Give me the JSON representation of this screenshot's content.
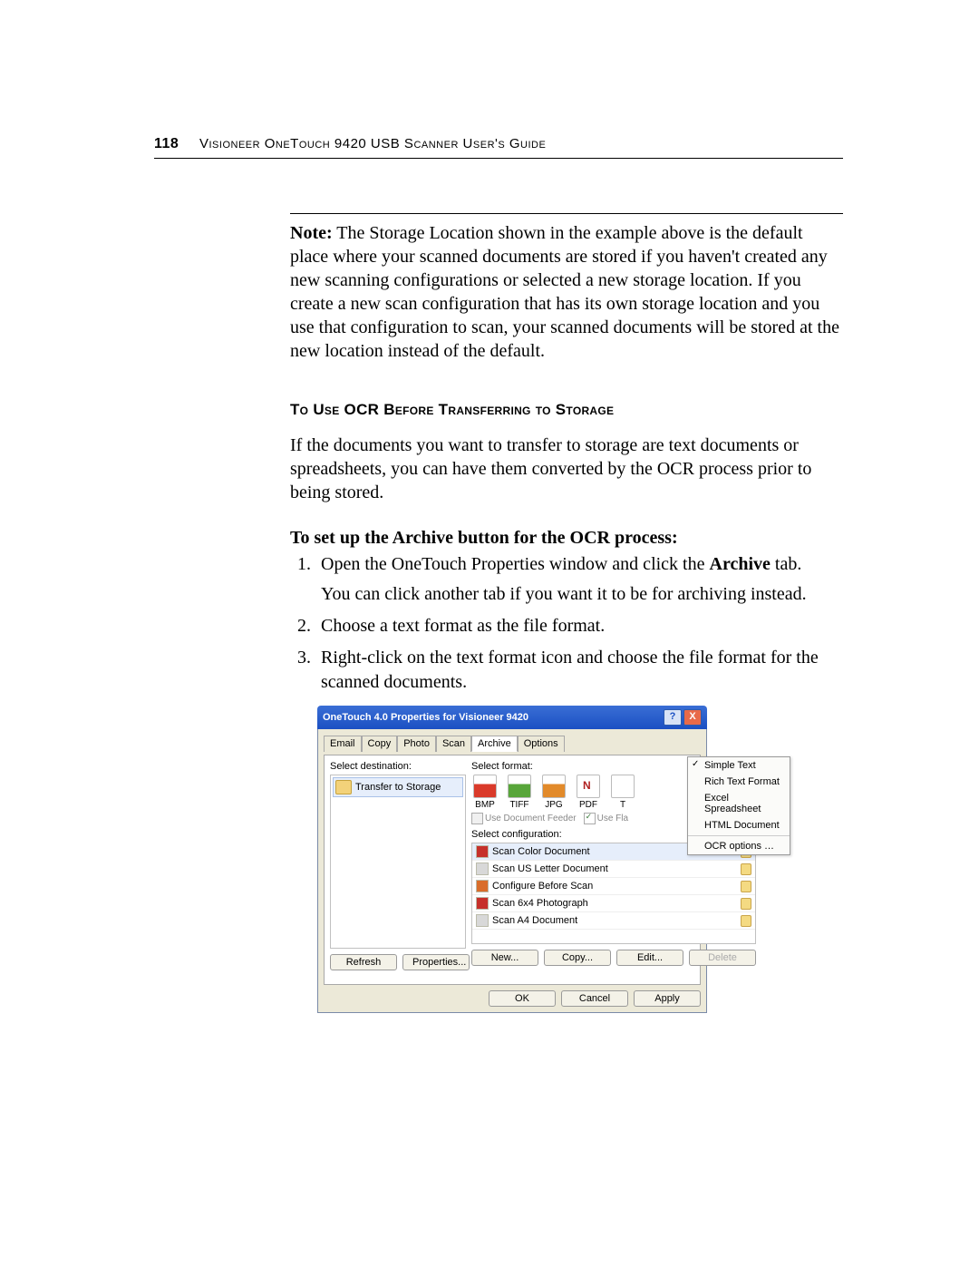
{
  "header": {
    "page_number": "118",
    "title": "Visioneer OneTouch 9420 USB Scanner User's Guide"
  },
  "note": {
    "prefix": "Note:",
    "text": "  The Storage Location shown in the example above is the default place where your scanned documents are stored if you haven't created any new scanning configurations or selected a new storage location. If you create a new scan configuration that has its own storage location and you use that configuration to scan, your scanned documents will be stored at the new location instead of the default."
  },
  "section_heading": "To Use OCR Before Transferring to Storage",
  "intro": "If the documents you want to transfer to storage are text documents or spreadsheets, you can have them converted by the OCR process prior to being stored.",
  "steps_heading": "To set up the Archive button for the OCR process:",
  "steps": {
    "s1a": "Open the OneTouch Properties window and click the ",
    "s1b": "Archive",
    "s1c": " tab.",
    "s1_sub": "You can click another tab if you want it to be for archiving instead.",
    "s2": "Choose a text format as the file format.",
    "s3": "Right-click on the text format icon and choose the file format for the scanned documents."
  },
  "dialog": {
    "title": "OneTouch 4.0 Properties for Visioneer 9420",
    "help": "?",
    "close": "X",
    "tabs": [
      "Email",
      "Copy",
      "Photo",
      "Scan",
      "Archive",
      "Options"
    ],
    "active_tab_index": 4,
    "select_dest_label": "Select destination:",
    "destination": "Transfer to Storage",
    "select_format_label": "Select format:",
    "formats": [
      "BMP",
      "TIFF",
      "JPG",
      "PDF",
      "T"
    ],
    "use_doc_feeder": "Use Document Feeder",
    "use_fla": "Use Fla",
    "select_config_label": "Select configuration:",
    "configs": [
      "Scan Color Document",
      "Scan US Letter Document",
      "Configure Before Scan",
      "Scan 6x4 Photograph",
      "Scan A4 Document"
    ],
    "left_buttons": [
      "Refresh",
      "Properties..."
    ],
    "right_buttons": [
      "New...",
      "Copy...",
      "Edit...",
      "Delete"
    ],
    "footer_buttons": [
      "OK",
      "Cancel",
      "Apply"
    ]
  },
  "context_menu": {
    "items": [
      "Simple Text",
      "Rich Text Format",
      "Excel Spreadsheet",
      "HTML Document"
    ],
    "checked_index": 0,
    "ocr": "OCR options …"
  }
}
